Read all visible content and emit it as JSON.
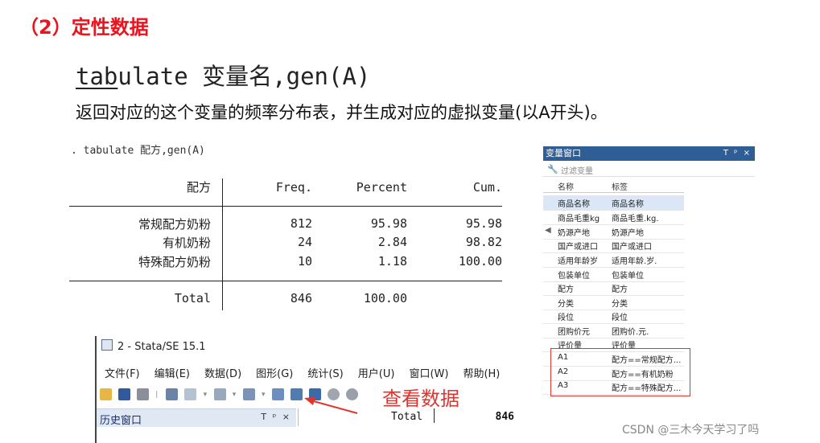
{
  "heading": "（2）定性数据",
  "syntax": {
    "cmd_underlined": "tab",
    "cmd_rest": "ulate ",
    "var_word": "变量名",
    "gen": ",gen(A)"
  },
  "description": "返回对应的这个变量的频率分布表，并生成对应的虚拟变量(以A开头)。",
  "stata_command": ". tabulate 配方,gen(A)",
  "freq_table": {
    "col_var": "配方",
    "col_freq": "Freq.",
    "col_percent": "Percent",
    "col_cum": "Cum.",
    "rows": [
      {
        "label": "常规配方奶粉",
        "freq": "812",
        "percent": "95.98",
        "cum": "95.98"
      },
      {
        "label": "有机奶粉",
        "freq": "24",
        "percent": "2.84",
        "cum": "98.82"
      },
      {
        "label": "特殊配方奶粉",
        "freq": "10",
        "percent": "1.18",
        "cum": "100.00"
      }
    ],
    "total_label": "Total",
    "total_freq": "846",
    "total_percent": "100.00"
  },
  "variable_window": {
    "title": "变量窗口",
    "controls": "T ᵖ ×",
    "filter_placeholder": "过滤变量",
    "col_name": "名称",
    "col_label": "标签",
    "rows": [
      {
        "name": "商品名称",
        "label": "商品名称",
        "selected": true
      },
      {
        "name": "商品毛重kg",
        "label": "商品毛重.kg."
      },
      {
        "name": "奶源产地",
        "label": "奶源产地"
      },
      {
        "name": "国产或进口",
        "label": "国产或进口"
      },
      {
        "name": "适用年龄岁",
        "label": "适用年龄.岁."
      },
      {
        "name": "包装单位",
        "label": "包装单位"
      },
      {
        "name": "配方",
        "label": "配方"
      },
      {
        "name": "分类",
        "label": "分类"
      },
      {
        "name": "段位",
        "label": "段位"
      },
      {
        "name": "团购价元",
        "label": "团购价.元."
      },
      {
        "name": "评价量",
        "label": "评价量"
      },
      {
        "name": "A1",
        "label": "配方==常规配方..."
      },
      {
        "name": "A2",
        "label": "配方==有机奶粉"
      },
      {
        "name": "A3",
        "label": "配方==特殊配方..."
      }
    ]
  },
  "stata_window": {
    "title": "2 - Stata/SE 15.1",
    "menus": [
      "文件(F)",
      "编辑(E)",
      "数据(D)",
      "图形(G)",
      "统计(S)",
      "用户(U)",
      "窗口(W)",
      "帮助(H)"
    ],
    "history_label": "历史窗口",
    "history_controls": "T ᵖ ×",
    "mini_total_label": "Total",
    "mini_total_value": "846"
  },
  "callout": "查看数据",
  "watermark": "CSDN @三木今天学习了吗",
  "colors": {
    "heading": "#e8141e",
    "callout": "#e0352e",
    "titlebar": "#2e5e95"
  }
}
